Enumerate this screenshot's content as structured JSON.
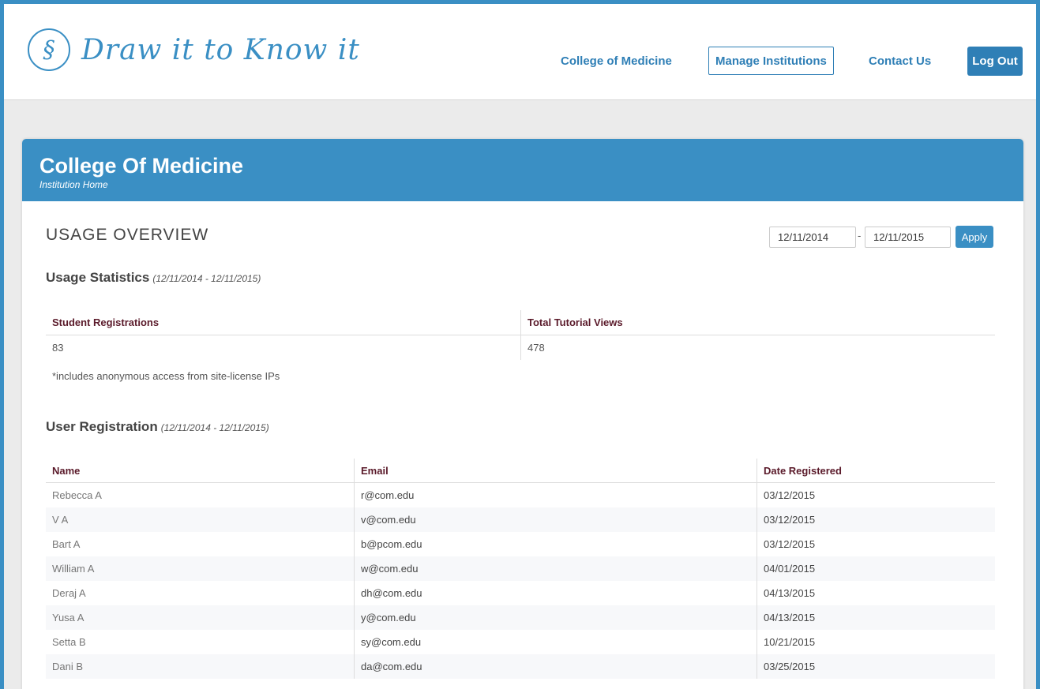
{
  "header": {
    "logo_text": "Draw it to Know it",
    "nav": {
      "college": "College of Medicine",
      "manage": "Manage Institutions",
      "contact": "Contact Us",
      "logout": "Log Out"
    }
  },
  "panel": {
    "title": "College Of Medicine",
    "subtitle": "Institution Home"
  },
  "overview": {
    "title": "USAGE OVERVIEW",
    "date_from": "12/11/2014",
    "date_to": "12/11/2015",
    "separator": "-",
    "apply_label": "Apply"
  },
  "usage_statistics": {
    "title": "Usage Statistics",
    "range": "(12/11/2014 - 12/11/2015)",
    "headers": [
      "Student Registrations",
      "Total Tutorial Views"
    ],
    "values": [
      "83",
      "478"
    ],
    "note": "*includes anonymous access from site-license IPs"
  },
  "user_registration": {
    "title": "User Registration",
    "range": "(12/11/2014 - 12/11/2015)",
    "headers": [
      "Name",
      "Email",
      "Date Registered"
    ],
    "rows": [
      {
        "name": "Rebecca A",
        "email": "r@com.edu",
        "date": "03/12/2015"
      },
      {
        "name": "V A",
        "email": "v@com.edu",
        "date": "03/12/2015"
      },
      {
        "name": "Bart A",
        "email": "b@pcom.edu",
        "date": "03/12/2015"
      },
      {
        "name": "William A",
        "email": "w@com.edu",
        "date": "04/01/2015"
      },
      {
        "name": "Deraj A",
        "email": "dh@com.edu",
        "date": "04/13/2015"
      },
      {
        "name": "Yusa A",
        "email": "y@com.edu",
        "date": "04/13/2015"
      },
      {
        "name": "Setta B",
        "email": "sy@com.edu",
        "date": "10/21/2015"
      },
      {
        "name": "Dani B",
        "email": "da@com.edu",
        "date": "03/25/2015"
      }
    ]
  },
  "colors": {
    "brand_blue": "#3a8fc4",
    "header_text": "#5a1a2a"
  }
}
